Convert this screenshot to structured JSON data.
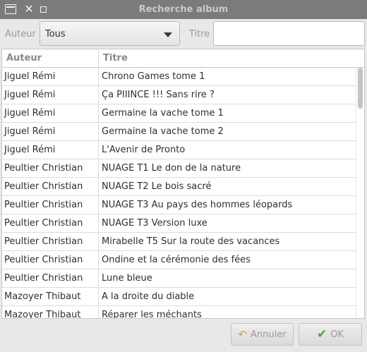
{
  "window": {
    "title": "Recherche album"
  },
  "filters": {
    "auteur_label": "Auteur",
    "auteur_selected": "Tous",
    "titre_label": "Titre",
    "titre_value": ""
  },
  "table": {
    "columns": [
      "Auteur",
      "Titre"
    ],
    "rows": [
      {
        "auteur": "Jiguel Rémi",
        "titre": "Chrono Games tome 1"
      },
      {
        "auteur": "Jiguel Rémi",
        "titre": "Ça PIIINCE !!! Sans rire ?"
      },
      {
        "auteur": "Jiguel Rémi",
        "titre": "Germaine la vache tome 1"
      },
      {
        "auteur": "Jiguel Rémi",
        "titre": "Germaine la vache tome 2"
      },
      {
        "auteur": "Jiguel Rémi",
        "titre": "L'Avenir de Pronto"
      },
      {
        "auteur": "Peultier Christian",
        "titre": "NUAGE T1 Le don de la nature"
      },
      {
        "auteur": "Peultier Christian",
        "titre": "NUAGE T2 Le bois sacré"
      },
      {
        "auteur": "Peultier Christian",
        "titre": "NUAGE T3 Au pays des hommes léopards"
      },
      {
        "auteur": "Peultier Christian",
        "titre": "NUAGE T3 Version luxe"
      },
      {
        "auteur": "Peultier Christian",
        "titre": "Mirabelle T5 Sur la route des vacances"
      },
      {
        "auteur": "Peultier Christian",
        "titre": "Ondine et la cérémonie des fées"
      },
      {
        "auteur": "Peultier Christian",
        "titre": "Lune bleue"
      },
      {
        "auteur": "Mazoyer Thibaut",
        "titre": "A la droite du diable"
      },
      {
        "auteur": "Mazoyer Thibaut",
        "titre": "Réparer les méchants"
      }
    ]
  },
  "buttons": {
    "cancel_label": "Annuler",
    "cancel_icon": "undo-icon",
    "ok_label": "OK",
    "ok_icon": "check-icon"
  }
}
